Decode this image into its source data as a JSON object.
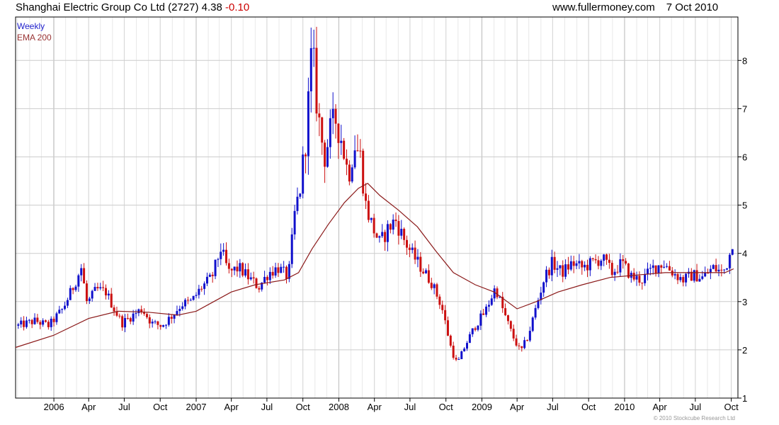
{
  "header": {
    "title": "Shanghai Electric Group Co Ltd (2727)",
    "price": "4.38",
    "change": "-0.10",
    "site": "www.fullermoney.com",
    "date": "7 Oct 2010"
  },
  "legend": {
    "weekly": "Weekly",
    "ema": "EMA 200"
  },
  "copyright": "© 2010 Stockcube Research Ltd",
  "colors": {
    "up": "#1010cc",
    "down": "#cc1010",
    "ema": "#8b1a1a",
    "grid": "#cccccc",
    "frame": "#000000"
  },
  "chart_data": {
    "type": "candlestick",
    "period": "Weekly",
    "ylim": [
      1,
      8.9
    ],
    "yticks": [
      1,
      2,
      3,
      4,
      5,
      6,
      7,
      8
    ],
    "xlim": [
      "2005-09-26",
      "2010-10-18"
    ],
    "grid": true,
    "y_axis_side": "right",
    "xticks": [
      {
        "label": "2006",
        "date": "2006-01-02",
        "year": true
      },
      {
        "label": "Apr",
        "date": "2006-04-01"
      },
      {
        "label": "Jul",
        "date": "2006-07-01"
      },
      {
        "label": "Oct",
        "date": "2006-10-01"
      },
      {
        "label": "2007",
        "date": "2007-01-01",
        "year": true
      },
      {
        "label": "Apr",
        "date": "2007-04-01"
      },
      {
        "label": "Jul",
        "date": "2007-07-01"
      },
      {
        "label": "Oct",
        "date": "2007-10-01"
      },
      {
        "label": "2008",
        "date": "2008-01-01",
        "year": true
      },
      {
        "label": "Apr",
        "date": "2008-04-01"
      },
      {
        "label": "Jul",
        "date": "2008-07-01"
      },
      {
        "label": "Oct",
        "date": "2008-10-01"
      },
      {
        "label": "2009",
        "date": "2009-01-01",
        "year": true
      },
      {
        "label": "Apr",
        "date": "2009-04-01"
      },
      {
        "label": "Jul",
        "date": "2009-07-01"
      },
      {
        "label": "Oct",
        "date": "2009-10-01"
      },
      {
        "label": "2010",
        "date": "2010-01-01",
        "year": true
      },
      {
        "label": "Apr",
        "date": "2010-04-01"
      },
      {
        "label": "Jul",
        "date": "2010-07-01"
      },
      {
        "label": "Oct",
        "date": "2010-10-01"
      }
    ],
    "price_path": [
      [
        "2005-10-03",
        2.5
      ],
      [
        "2005-11-15",
        2.6
      ],
      [
        "2005-12-20",
        2.5
      ],
      [
        "2006-01-25",
        2.85
      ],
      [
        "2006-02-20",
        3.3
      ],
      [
        "2006-03-13",
        3.7
      ],
      [
        "2006-03-28",
        2.95
      ],
      [
        "2006-04-20",
        3.25
      ],
      [
        "2006-05-15",
        3.2
      ],
      [
        "2006-06-05",
        2.85
      ],
      [
        "2006-06-25",
        2.55
      ],
      [
        "2006-07-20",
        2.7
      ],
      [
        "2006-08-15",
        2.85
      ],
      [
        "2006-09-10",
        2.55
      ],
      [
        "2006-10-05",
        2.5
      ],
      [
        "2006-10-30",
        2.7
      ],
      [
        "2006-11-25",
        2.95
      ],
      [
        "2006-12-20",
        3.0
      ],
      [
        "2007-01-15",
        3.3
      ],
      [
        "2007-02-10",
        3.5
      ],
      [
        "2007-03-05",
        4.1
      ],
      [
        "2007-03-25",
        3.6
      ],
      [
        "2007-04-20",
        3.7
      ],
      [
        "2007-05-15",
        3.5
      ],
      [
        "2007-06-10",
        3.3
      ],
      [
        "2007-07-05",
        3.6
      ],
      [
        "2007-07-30",
        3.7
      ],
      [
        "2007-08-25",
        3.5
      ],
      [
        "2007-09-10",
        4.8
      ],
      [
        "2007-09-25",
        5.4
      ],
      [
        "2007-10-10",
        6.5
      ],
      [
        "2007-10-24",
        8.2
      ],
      [
        "2007-11-10",
        6.8
      ],
      [
        "2007-11-25",
        6.0
      ],
      [
        "2007-12-10",
        6.5
      ],
      [
        "2007-12-25",
        6.8
      ],
      [
        "2008-01-10",
        6.3
      ],
      [
        "2008-01-25",
        5.6
      ],
      [
        "2008-02-10",
        6.3
      ],
      [
        "2008-02-25",
        6.0
      ],
      [
        "2008-03-10",
        5.0
      ],
      [
        "2008-03-25",
        4.6
      ],
      [
        "2008-04-15",
        4.2
      ],
      [
        "2008-05-05",
        4.5
      ],
      [
        "2008-05-25",
        4.7
      ],
      [
        "2008-06-15",
        4.3
      ],
      [
        "2008-07-05",
        4.0
      ],
      [
        "2008-07-30",
        3.7
      ],
      [
        "2008-08-25",
        3.4
      ],
      [
        "2008-09-20",
        2.9
      ],
      [
        "2008-10-15",
        2.0
      ],
      [
        "2008-10-30",
        1.7
      ],
      [
        "2008-11-20",
        2.1
      ],
      [
        "2008-12-15",
        2.5
      ],
      [
        "2009-01-10",
        2.8
      ],
      [
        "2009-02-05",
        3.3
      ],
      [
        "2009-02-25",
        2.8
      ],
      [
        "2009-03-20",
        2.3
      ],
      [
        "2009-04-10",
        1.95
      ],
      [
        "2009-04-30",
        2.3
      ],
      [
        "2009-05-20",
        2.9
      ],
      [
        "2009-06-10",
        3.5
      ],
      [
        "2009-06-30",
        3.8
      ],
      [
        "2009-07-25",
        3.6
      ],
      [
        "2009-08-20",
        3.8
      ],
      [
        "2009-09-15",
        3.7
      ],
      [
        "2009-10-10",
        3.8
      ],
      [
        "2009-11-05",
        3.9
      ],
      [
        "2009-11-30",
        3.6
      ],
      [
        "2009-12-25",
        3.8
      ],
      [
        "2010-01-20",
        3.5
      ],
      [
        "2010-02-15",
        3.45
      ],
      [
        "2010-03-15",
        3.7
      ],
      [
        "2010-04-10",
        3.8
      ],
      [
        "2010-05-05",
        3.6
      ],
      [
        "2010-05-30",
        3.45
      ],
      [
        "2010-06-25",
        3.55
      ],
      [
        "2010-07-20",
        3.5
      ],
      [
        "2010-08-15",
        3.7
      ],
      [
        "2010-09-10",
        3.6
      ],
      [
        "2010-09-25",
        3.9
      ],
      [
        "2010-10-07",
        4.38
      ]
    ],
    "ema_path": [
      [
        "2005-09-26",
        2.05
      ],
      [
        "2006-01-01",
        2.3
      ],
      [
        "2006-04-01",
        2.65
      ],
      [
        "2006-06-15",
        2.8
      ],
      [
        "2006-09-01",
        2.78
      ],
      [
        "2006-11-15",
        2.72
      ],
      [
        "2007-01-01",
        2.8
      ],
      [
        "2007-02-15",
        3.0
      ],
      [
        "2007-04-01",
        3.2
      ],
      [
        "2007-06-01",
        3.35
      ],
      [
        "2007-08-15",
        3.45
      ],
      [
        "2007-09-20",
        3.6
      ],
      [
        "2007-10-25",
        4.1
      ],
      [
        "2007-12-05",
        4.6
      ],
      [
        "2008-01-15",
        5.05
      ],
      [
        "2008-02-20",
        5.35
      ],
      [
        "2008-03-15",
        5.45
      ],
      [
        "2008-04-15",
        5.2
      ],
      [
        "2008-06-01",
        4.9
      ],
      [
        "2008-07-20",
        4.55
      ],
      [
        "2008-09-05",
        4.05
      ],
      [
        "2008-10-20",
        3.6
      ],
      [
        "2008-12-15",
        3.35
      ],
      [
        "2009-02-01",
        3.2
      ],
      [
        "2009-04-01",
        2.85
      ],
      [
        "2009-05-20",
        3.0
      ],
      [
        "2009-07-15",
        3.2
      ],
      [
        "2009-09-15",
        3.35
      ],
      [
        "2009-11-25",
        3.5
      ],
      [
        "2010-02-01",
        3.55
      ],
      [
        "2010-04-15",
        3.6
      ],
      [
        "2010-07-15",
        3.6
      ],
      [
        "2010-09-15",
        3.6
      ],
      [
        "2010-10-07",
        3.68
      ]
    ]
  }
}
